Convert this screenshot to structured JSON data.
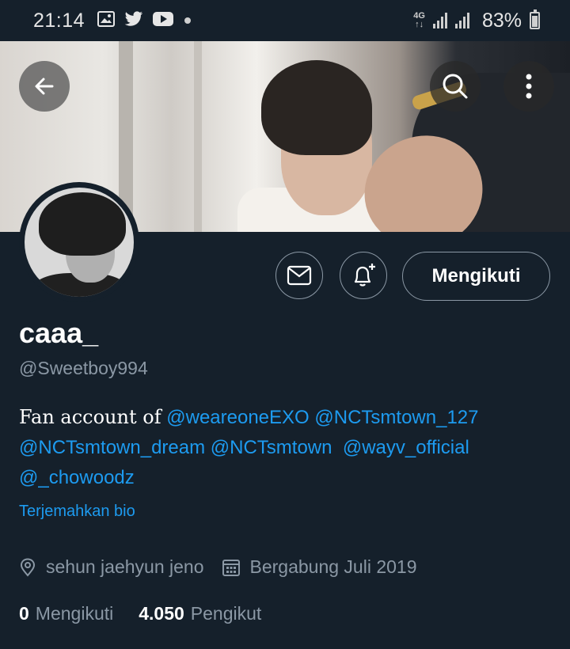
{
  "status_bar": {
    "time": "21:14",
    "notification_icons": [
      "gallery-icon",
      "twitter-icon",
      "youtube-icon"
    ],
    "network_label": "4G",
    "battery": "83%"
  },
  "header": {
    "back_icon": "arrow-left-icon",
    "search_icon": "search-icon",
    "more_icon": "more-vertical-icon"
  },
  "profile": {
    "display_name": "caaa_",
    "handle": "@Sweetboy994",
    "bio_prefix": "Fan account of",
    "bio_mentions": [
      "@weareoneEXO",
      "@NCTsmtown_127",
      "@NCTsmtown_dream",
      "@NCTsmtown",
      "@wayv_official",
      "@_chowoodz"
    ],
    "translate_label": "Terjemahkan bio",
    "location": "sehun jaehyun jeno",
    "joined": "Bergabung Juli 2019",
    "following_count": "0",
    "following_label": "Mengikuti",
    "followers_count": "4.050",
    "followers_label": "Pengikut"
  },
  "actions": {
    "follow_label": "Mengikuti",
    "message_icon": "mail-icon",
    "notify_icon": "bell-plus-icon"
  },
  "colors": {
    "background": "#15202b",
    "link": "#1d9bf0",
    "secondary_text": "#8b98a5"
  }
}
